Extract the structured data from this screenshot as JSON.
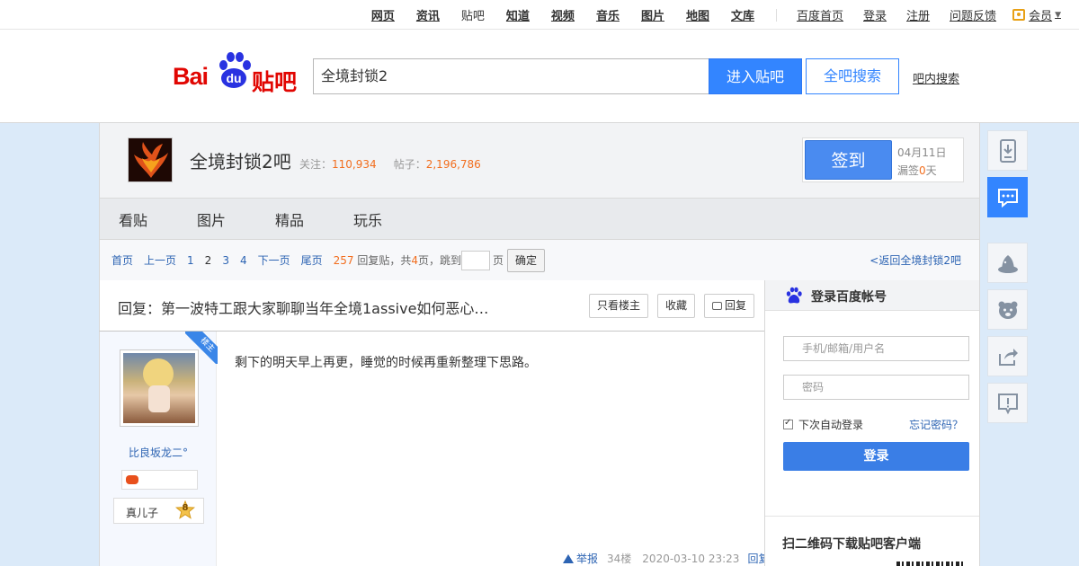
{
  "topnav": {
    "links": [
      "网页",
      "资讯",
      "贴吧",
      "知道",
      "视频",
      "音乐",
      "图片",
      "地图",
      "文库"
    ],
    "util": [
      "百度首页",
      "登录",
      "注册",
      "问题反馈"
    ],
    "member": "会员"
  },
  "header": {
    "logo_text": "Bai",
    "logo_paw": "du",
    "logo_suffix": "贴吧",
    "search_value": "全境封锁2",
    "enter_button": "进入贴吧",
    "search_all_button": "全吧搜索",
    "in_bar_search": "吧内搜索"
  },
  "forum": {
    "name": "全境封锁2吧",
    "follow_label": "关注：",
    "follow_count": "110,934",
    "post_label": "帖子：",
    "post_count": "2,196,786",
    "checkin_button": "签到",
    "checkin_date": "04月11日",
    "missed_prefix": "漏签",
    "missed_count": "0",
    "missed_suffix": "天"
  },
  "tabs": [
    "看贴",
    "图片",
    "精品",
    "玩乐"
  ],
  "pager": {
    "first": "首页",
    "prev": "上一页",
    "pages": [
      "1",
      "2",
      "3",
      "4"
    ],
    "current": "2",
    "next": "下一页",
    "last": "尾页",
    "reply_count": "257",
    "reply_label": "回复贴，共",
    "page_total": "4",
    "page_label": "页，跳到",
    "page_unit": "页",
    "confirm": "确定",
    "back_link": "<返回全境封锁2吧"
  },
  "post": {
    "title": "回复：第一波特工跟大家聊聊当年全境1assive如何恶心…",
    "only_owner": "只看楼主",
    "favorite": "收藏",
    "reply": "回复",
    "owner_badge": "楼主",
    "username": "比良坂龙二°",
    "level_name": "真儿子",
    "level_num": "8",
    "content": "剩下的明天早上再更，睡觉的时候再重新整理下思路。",
    "report": "举报",
    "floor": "34楼",
    "time": "2020-03-10 23:23",
    "reply_link": "回复"
  },
  "login": {
    "title": "登录百度帐号",
    "user_placeholder": "手机/邮箱/用户名",
    "pass_placeholder": "密码",
    "remember": "下次自动登录",
    "forgot": "忘记密码？",
    "login_button": "登录",
    "qr_title": "扫二维码下载贴吧客户端"
  },
  "colors": {
    "brand_red": "#e10602",
    "brand_blue": "#2932e1",
    "accent_blue": "#3385ff",
    "count_orange": "#f26e1e",
    "link_blue": "#2d64b3"
  },
  "sidebar_icons": [
    "download-app-icon",
    "message-icon",
    "wizard-hat-icon",
    "bear-face-icon",
    "share-icon",
    "feedback-icon"
  ]
}
